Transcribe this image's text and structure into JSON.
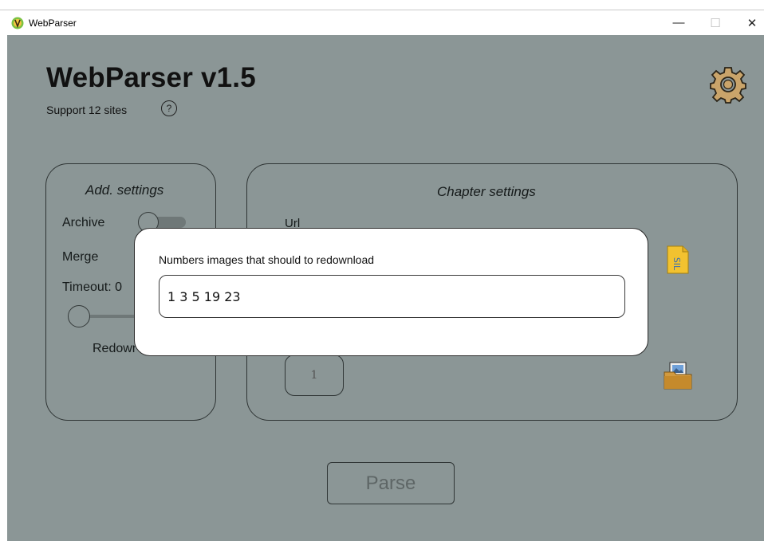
{
  "window": {
    "title": "WebParser",
    "controls": {
      "minimize": "—",
      "maximize": "☐",
      "close": "✕"
    }
  },
  "app": {
    "title": "WebParser v1.5",
    "subtitle": "Support 12 sites",
    "help_symbol": "?"
  },
  "add_settings": {
    "heading": "Add. settings",
    "archive_label": "Archive",
    "archive_enabled": false,
    "merge_label": "Merge",
    "timeout_label": "Timeout: 0",
    "timeout_value": 0,
    "redownload_label": "Redowr"
  },
  "chapter_settings": {
    "heading": "Chapter settings",
    "url_label": "Url",
    "page_value": "1"
  },
  "parse_button": "Parse",
  "modal": {
    "label": "Numbers images that should to redownload",
    "input_value": "1 3 5 19 23"
  },
  "colors": {
    "background": "#8b9696",
    "panel_border": "#2f3535",
    "modal_background": "#ffffff"
  },
  "icons": {
    "app": "parser-app-icon",
    "help": "question-circle-icon",
    "settings": "gear-icon",
    "file": "file-icon",
    "folder": "image-folder-icon"
  }
}
